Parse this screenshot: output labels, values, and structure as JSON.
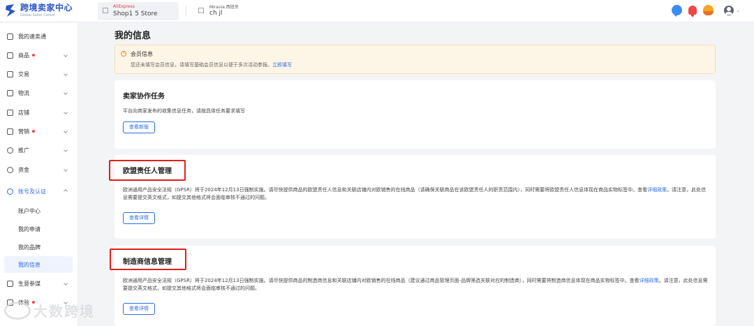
{
  "header": {
    "logo_title": "跨境卖家中心",
    "logo_sub": "Global Seller Center",
    "store1_brand": "AliExpress",
    "store1_name": "Shop1                5 Store",
    "store2_brand": "Miravia 西班牙",
    "store2_name": "ch        jl"
  },
  "sidebar": {
    "items": [
      {
        "label": "我的速卖通",
        "icon": "home-icon"
      },
      {
        "label": "商品",
        "icon": "product-icon"
      },
      {
        "label": "交易",
        "icon": "trade-icon"
      },
      {
        "label": "物流",
        "icon": "logistics-icon"
      },
      {
        "label": "店铺",
        "icon": "store-icon"
      },
      {
        "label": "营销",
        "icon": "marketing-icon"
      },
      {
        "label": "推广",
        "icon": "promotion-icon"
      },
      {
        "label": "资金",
        "icon": "funds-icon"
      },
      {
        "label": "账号及认证",
        "icon": "account-icon"
      },
      {
        "label": "生意参谋",
        "icon": "analytics-icon"
      },
      {
        "label": "体验",
        "icon": "experience-icon"
      }
    ],
    "sub_items": [
      {
        "label": "账户中心"
      },
      {
        "label": "我的申请"
      },
      {
        "label": "我的品牌"
      },
      {
        "label": "我的信息"
      }
    ]
  },
  "main": {
    "page_title": "我的信息",
    "notice": {
      "title": "会员信息",
      "desc": "您还未填写会员信息，请填写基础会员信息以便于多次活动参报。",
      "link": "立即填写"
    },
    "cards": [
      {
        "title": "卖家协作任务",
        "text": "平台向商家发布的收集信息任务，请按具体任务要求填写",
        "button": "查看新版"
      },
      {
        "title": "欧盟责任人管理",
        "text_a": "欧洲通用产品安全法规（GPSR）将于2024年12月13日强制实施。请尽快提供商品的欧盟责任人信息和关联店铺内对欧销售的在线商品（请确保关联商品在该欧盟责任人的职责范围内），同时需要将欧盟责任人信息体现在商品实物标",
        "text_b": "签中。查看",
        "link": "详细政策",
        "text_c": "。请注意，此处信息需要提交英文格式，如提交其他格式将会面临审核不通过的问题。",
        "button": "查看详情"
      },
      {
        "title": "制造商信息管理",
        "text_a": "欧洲通用产品安全法规（GPSR）将于2024年12月13日强制实施。请尽快提供商品的制造商信息和关联店铺内对欧销售的在线商品（建议通过商品管理页面-品牌筛选关联对应的制造商），同时需要将制造商信息体现在商品实物标签",
        "text_b": "中。查看",
        "link": "详细政策",
        "text_c": "。请注意，此处信息需要提交英文格式，如提交其他格式将会面临审核不通过的问题。",
        "button": "查看详情"
      }
    ]
  },
  "watermark": "大数跨境",
  "colors": {
    "accent": "#2b6de5",
    "alert_red": "#e0201b",
    "notice_bg": "#fdf5e6"
  }
}
